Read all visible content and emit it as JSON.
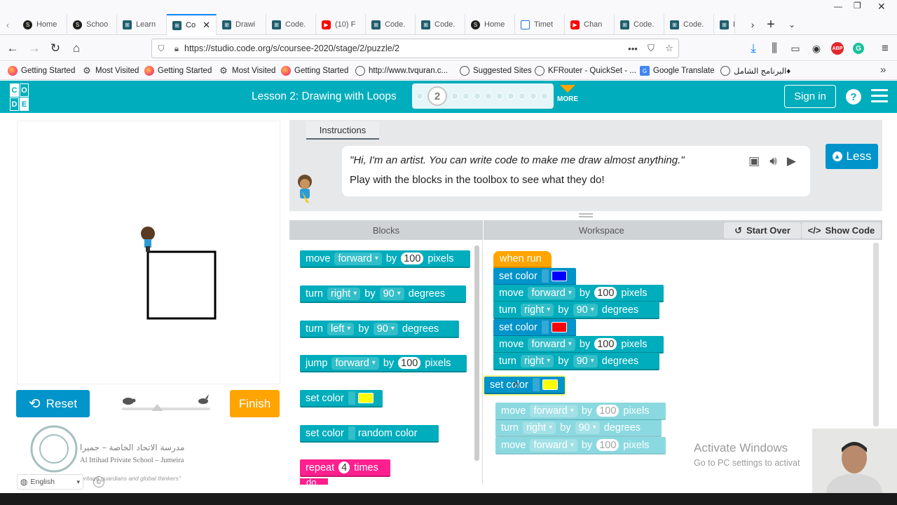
{
  "browser": {
    "tabs": [
      {
        "label": "Home",
        "icon": "schoology-icon"
      },
      {
        "label": "Schoo",
        "icon": "schoology-icon"
      },
      {
        "label": "Learn",
        "icon": "code-icon"
      },
      {
        "label": "Co",
        "icon": "code-icon",
        "active": true
      },
      {
        "label": "Drawi",
        "icon": "code-icon"
      },
      {
        "label": "Code.",
        "icon": "code-icon"
      },
      {
        "label": "(10) F",
        "icon": "youtube-icon"
      },
      {
        "label": "Code.",
        "icon": "code-icon"
      },
      {
        "label": "Code.",
        "icon": "code-icon"
      },
      {
        "label": "Home",
        "icon": "schoology-icon"
      },
      {
        "label": "Timet",
        "icon": "calendar-icon"
      },
      {
        "label": "Chan",
        "icon": "youtube-icon"
      },
      {
        "label": "Code.",
        "icon": "code-icon"
      },
      {
        "label": "Code.",
        "icon": "code-icon"
      },
      {
        "label": "D",
        "icon": "code-icon"
      }
    ],
    "url": "https://studio.code.org/s/coursee-2020/stage/2/puzzle/2",
    "bookmarks": [
      {
        "label": "Getting Started",
        "icon": "firefox-icon"
      },
      {
        "label": "Most Visited",
        "icon": "gear-icon"
      },
      {
        "label": "Getting Started",
        "icon": "firefox-icon"
      },
      {
        "label": "Most Visited",
        "icon": "gear-icon"
      },
      {
        "label": "Getting Started",
        "icon": "firefox-icon"
      },
      {
        "label": "http://www.tvquran.c...",
        "icon": "globe-icon"
      },
      {
        "label": "Suggested Sites",
        "icon": "globe-icon"
      },
      {
        "label": "KFRouter - QuickSet - ...",
        "icon": "globe-icon"
      },
      {
        "label": "Google Translate",
        "icon": "google-translate-icon"
      },
      {
        "label": "البرنامج الشامل♦",
        "icon": "globe-icon"
      }
    ]
  },
  "header": {
    "logo": [
      "C",
      "O",
      "D",
      "E"
    ],
    "lesson_title": "Lesson 2: Drawing with Loops",
    "current_puzzle": "2",
    "more_label": "MORE",
    "signin_label": "Sign in",
    "help_label": "?"
  },
  "play_area": {
    "reset_label": "Reset",
    "finish_label": "Finish",
    "speed_fraction": 0.4,
    "language": "English",
    "school_name_ar": "مدرسة الاتحاد الخاصة – جميرا",
    "school_name_en": "Al Ittihad Private School – Jumeira",
    "school_tagline": "\"A generation of heritage guardians and global thinkers\""
  },
  "instructions": {
    "tab_label": "Instructions",
    "quote": "\"Hi, I'm an artist. You can write code to make me draw almost anything.\"",
    "text": "Play with the blocks in the toolbox to see what they do!",
    "less_label": "Less"
  },
  "editor": {
    "blocks_header": "Blocks",
    "workspace_header": "Workspace",
    "start_over_label": "Start Over",
    "show_code_label": "Show Code",
    "toolbox": {
      "move": {
        "t1": "move",
        "dir": "forward",
        "t2": "by",
        "n": "100",
        "t3": "pixels"
      },
      "turn_right": {
        "t1": "turn",
        "dir": "right",
        "t2": "by",
        "n": "90",
        "t3": "degrees"
      },
      "turn_left": {
        "t1": "turn",
        "dir": "left",
        "t2": "by",
        "n": "90",
        "t3": "degrees"
      },
      "jump": {
        "t1": "jump",
        "dir": "forward",
        "t2": "by",
        "n": "100",
        "t3": "pixels"
      },
      "set_color": {
        "t1": "set color",
        "color": "#ffff00"
      },
      "set_color_random": {
        "t1": "set color",
        "t2": "random color"
      },
      "repeat": {
        "t1": "repeat",
        "n": "4",
        "t2": "times",
        "t3": "do"
      }
    },
    "workspace": {
      "when_run": "when run",
      "set_color_1": {
        "t1": "set color",
        "color": "#0000ff"
      },
      "move_1": {
        "t1": "move",
        "dir": "forward",
        "t2": "by",
        "n": "100",
        "t3": "pixels"
      },
      "turn_1": {
        "t1": "turn",
        "dir": "right",
        "t2": "by",
        "n": "90",
        "t3": "degrees"
      },
      "set_color_2": {
        "t1": "set color",
        "color": "#ff0000"
      },
      "move_2": {
        "t1": "move",
        "dir": "forward",
        "t2": "by",
        "n": "100",
        "t3": "pixels"
      },
      "turn_2": {
        "t1": "turn",
        "dir": "right",
        "t2": "by",
        "n": "90",
        "t3": "degrees"
      },
      "set_color_drag": {
        "t1": "set color",
        "color": "#ffff00"
      },
      "ghost_move_1": {
        "t1": "move",
        "dir": "forward",
        "t2": "by",
        "n": "100",
        "t3": "pixels"
      },
      "ghost_turn": {
        "t1": "turn",
        "dir": "right",
        "t2": "by",
        "n": "90",
        "t3": "degrees"
      },
      "ghost_move_2": {
        "t1": "move",
        "dir": "forward",
        "t2": "by",
        "n": "100",
        "t3": "pixels"
      }
    }
  },
  "os_overlay": {
    "activate_title": "Activate Windows",
    "activate_sub": "Go to PC settings to activat"
  }
}
